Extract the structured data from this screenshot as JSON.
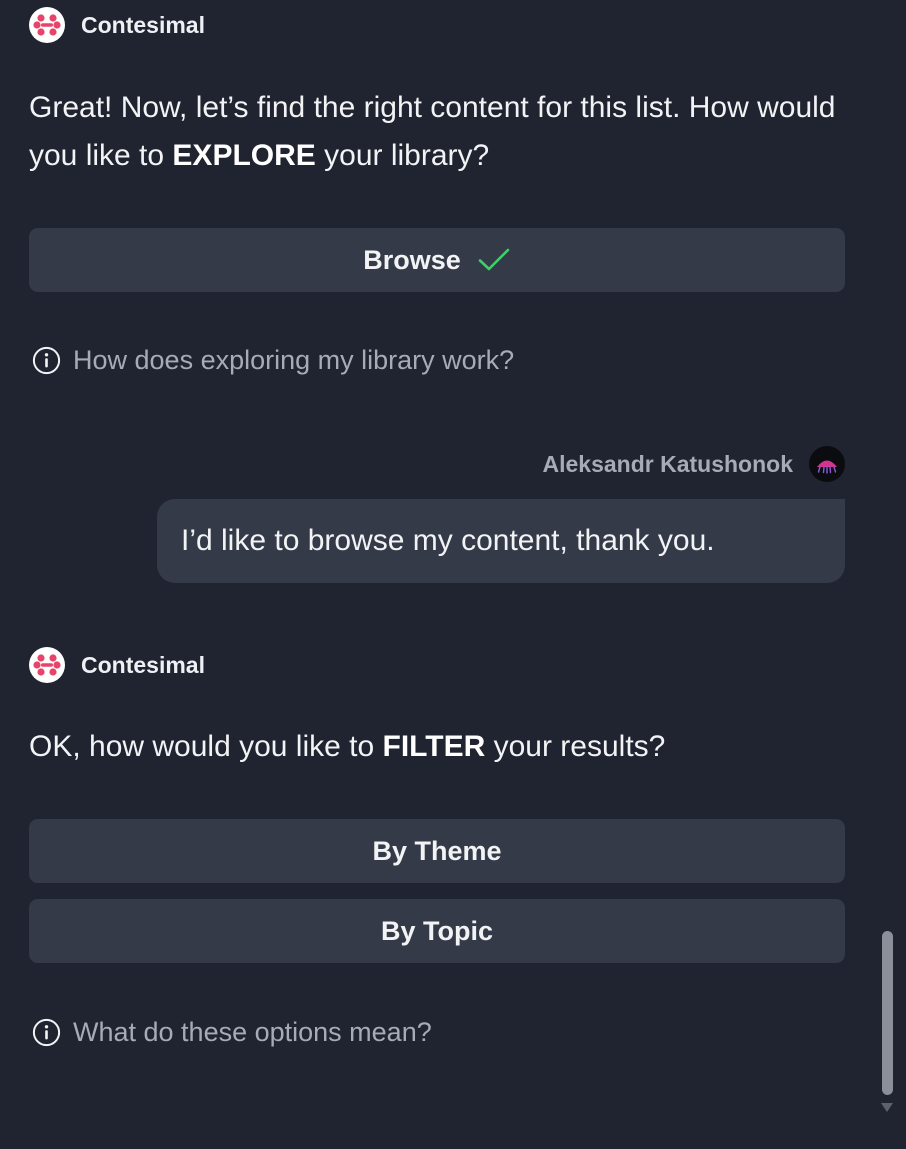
{
  "bot": {
    "name": "Contesimal",
    "logo_icon": "contesimal-logo-icon"
  },
  "messages": [
    {
      "type": "bot",
      "text_parts": [
        "Great! Now, let’s find the right content for this list. How would you like to ",
        "EXPLORE",
        " your library?"
      ],
      "options": [
        {
          "label": "Browse",
          "selected": true,
          "icon": "check-icon"
        }
      ],
      "help": {
        "icon": "info-icon",
        "text": "How does exploring my library work?"
      }
    },
    {
      "type": "user",
      "name": "Aleksandr Katushonok",
      "avatar_icon": "user-avatar",
      "text": "I’d like to browse my content, thank you."
    },
    {
      "type": "bot",
      "text_parts": [
        "OK, how would you like to ",
        "FILTER",
        " your results?"
      ],
      "options": [
        {
          "label": "By Theme",
          "selected": false
        },
        {
          "label": "By Topic",
          "selected": false
        }
      ],
      "help": {
        "icon": "info-icon",
        "text": "What do these options mean?"
      }
    }
  ],
  "colors": {
    "background": "#1f2430",
    "surface": "#343a48",
    "text": "#f2f3f5",
    "muted": "#a6abb6",
    "check": "#3ecf6a",
    "brand": "#e8446a"
  }
}
